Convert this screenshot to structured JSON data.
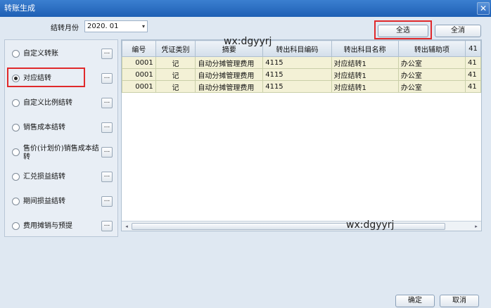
{
  "window": {
    "title": "转账生成",
    "close_glyph": "✕"
  },
  "month": {
    "label": "结转月份",
    "value": "2020. 01",
    "arrow": "▾"
  },
  "buttons": {
    "select_all": "全选",
    "clear_all": "全消",
    "ok": "确定",
    "cancel": "取消",
    "browse": "..."
  },
  "options": [
    {
      "label": "自定义转账",
      "selected": false
    },
    {
      "label": "对应结转",
      "selected": true
    },
    {
      "label": "自定义比例结转",
      "selected": false
    },
    {
      "label": "销售成本结转",
      "selected": false
    },
    {
      "label": "售价(计划价)销售成本结转",
      "selected": false
    },
    {
      "label": "汇兑损益结转",
      "selected": false
    },
    {
      "label": "期间损益结转",
      "selected": false
    },
    {
      "label": "费用摊销与预提",
      "selected": false
    }
  ],
  "table": {
    "columns": [
      "编号",
      "凭证类别",
      "摘要",
      "转出科目编码",
      "转出科目名称",
      "转出辅助项",
      "41"
    ],
    "rows": [
      [
        "0001",
        "记",
        "自动分摊管理费用",
        "4115",
        "对应结转1",
        "办公室",
        "41"
      ],
      [
        "0001",
        "记",
        "自动分摊管理费用",
        "4115",
        "对应结转1",
        "办公室",
        "41"
      ],
      [
        "0001",
        "记",
        "自动分摊管理费用",
        "4115",
        "对应结转1",
        "办公室",
        "41"
      ]
    ]
  },
  "scroll": {
    "left": "◂",
    "right": "▸"
  },
  "watermarks": [
    "wx:dgyyrj",
    "wx:dgyyrj"
  ]
}
